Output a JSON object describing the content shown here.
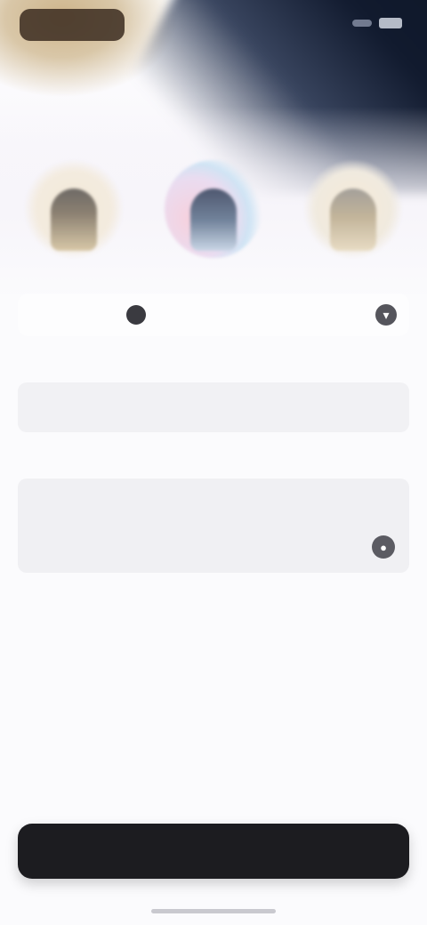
{
  "header": {
    "brand_label": "",
    "status_icons": [
      "signal-icon",
      "battery-icon"
    ]
  },
  "avatars": [
    {
      "name": "avatar-option-1",
      "style": "warm"
    },
    {
      "name": "avatar-option-2",
      "style": "pastel"
    },
    {
      "name": "avatar-option-3",
      "style": "cream"
    }
  ],
  "selector": {
    "prefix": "",
    "value": "",
    "icon": "chevron-down-icon"
  },
  "field1": {
    "label": "",
    "value": ""
  },
  "field2": {
    "label": "",
    "placeholder": "",
    "icon": "mic-icon"
  },
  "cta": {
    "label": ""
  },
  "colors": {
    "cta_background": "#1c1c20",
    "field_background": "#f1f1f4",
    "hero_dark": "#0c1524",
    "hero_warm": "#cdb38a"
  }
}
